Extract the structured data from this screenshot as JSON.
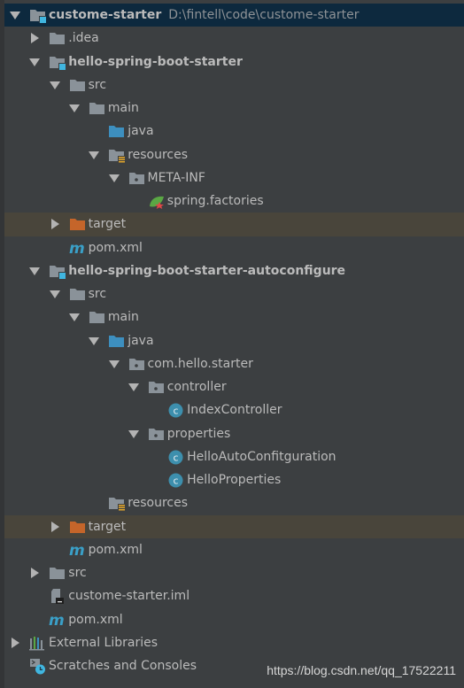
{
  "colors": {
    "background": "#3c3f41",
    "selected_row": "#0d293e",
    "highlight_row": "#49453b",
    "text": "#bbbbbb",
    "folder": "#8a9299",
    "source_folder": "#3d8fbf",
    "excluded_folder": "#c5652a",
    "class_icon": "#3d8fad",
    "maven": "#3aa0c8"
  },
  "tree": [
    {
      "level": 0,
      "state": "expanded",
      "icon": "module-folder-icon",
      "label": "custome-starter",
      "bold": true,
      "path": "D:\\fintell\\code\\custome-starter",
      "selected": true
    },
    {
      "level": 1,
      "state": "collapsed",
      "icon": "folder-icon",
      "label": ".idea"
    },
    {
      "level": 1,
      "state": "expanded",
      "icon": "module-folder-icon",
      "label": "hello-spring-boot-starter",
      "bold": true
    },
    {
      "level": 2,
      "state": "expanded",
      "icon": "folder-icon",
      "label": "src"
    },
    {
      "level": 3,
      "state": "expanded",
      "icon": "folder-icon",
      "label": "main"
    },
    {
      "level": 4,
      "state": "leaf",
      "icon": "source-folder-icon",
      "label": "java"
    },
    {
      "level": 4,
      "state": "expanded",
      "icon": "resources-folder-icon",
      "label": "resources"
    },
    {
      "level": 5,
      "state": "expanded",
      "icon": "package-icon",
      "label": "META-INF"
    },
    {
      "level": 6,
      "state": "leaf",
      "icon": "spring-icon",
      "label": "spring.factories"
    },
    {
      "level": 2,
      "state": "collapsed",
      "icon": "excluded-folder-icon",
      "label": "target",
      "highlight": true
    },
    {
      "level": 2,
      "state": "leaf",
      "icon": "maven-icon",
      "label": "pom.xml"
    },
    {
      "level": 1,
      "state": "expanded",
      "icon": "module-folder-icon",
      "label": "hello-spring-boot-starter-autoconfigure",
      "bold": true
    },
    {
      "level": 2,
      "state": "expanded",
      "icon": "folder-icon",
      "label": "src"
    },
    {
      "level": 3,
      "state": "expanded",
      "icon": "folder-icon",
      "label": "main"
    },
    {
      "level": 4,
      "state": "expanded",
      "icon": "source-folder-icon",
      "label": "java"
    },
    {
      "level": 5,
      "state": "expanded",
      "icon": "package-icon",
      "label": "com.hello.starter"
    },
    {
      "level": 6,
      "state": "expanded",
      "icon": "package-icon",
      "label": "controller"
    },
    {
      "level": 7,
      "state": "leaf",
      "icon": "class-icon",
      "label": "IndexController"
    },
    {
      "level": 6,
      "state": "expanded",
      "icon": "package-icon",
      "label": "properties"
    },
    {
      "level": 7,
      "state": "leaf",
      "icon": "class-icon",
      "label": "HelloAutoConfitguration"
    },
    {
      "level": 7,
      "state": "leaf",
      "icon": "class-icon",
      "label": "HelloProperties"
    },
    {
      "level": 4,
      "state": "leaf",
      "icon": "resources-folder-icon",
      "label": "resources"
    },
    {
      "level": 2,
      "state": "collapsed",
      "icon": "excluded-folder-icon",
      "label": "target",
      "highlight": true
    },
    {
      "level": 2,
      "state": "leaf",
      "icon": "maven-icon",
      "label": "pom.xml"
    },
    {
      "level": 1,
      "state": "collapsed",
      "icon": "folder-icon",
      "label": "src"
    },
    {
      "level": 1,
      "state": "leaf",
      "icon": "iml-file-icon",
      "label": "custome-starter.iml"
    },
    {
      "level": 1,
      "state": "leaf",
      "icon": "maven-icon",
      "label": "pom.xml"
    },
    {
      "level": 0,
      "state": "collapsed",
      "icon": "libraries-icon",
      "label": "External Libraries"
    },
    {
      "level": 0,
      "state": "leaf",
      "icon": "scratches-icon",
      "label": "Scratches and Consoles"
    }
  ],
  "watermark": "https://blog.csdn.net/qq_17522211"
}
